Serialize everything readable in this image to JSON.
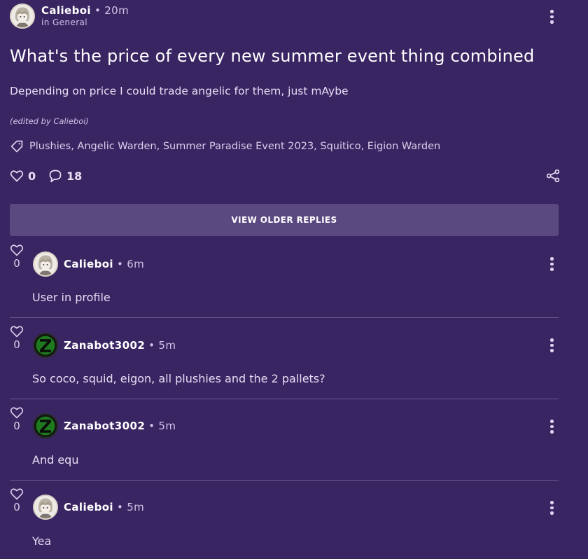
{
  "post": {
    "author": "Calieboi",
    "separator": "•",
    "time": "20m",
    "category": "in General",
    "title": "What's the price of every new summer event thing combined",
    "body": "Depending on price I could trade angelic for them, just mAybe",
    "edited_note": "(edited by Calieboi)",
    "tags": "Plushies, Angelic Warden, Summer Paradise Event 2023, Squitico, Eigion Warden",
    "likes": "0",
    "comments": "18"
  },
  "older_replies_label": "VIEW OLDER REPLIES",
  "replies": [
    {
      "author": "Calieboi",
      "time": "6m",
      "likes": "0",
      "text": "User in profile",
      "avatar": "calieboi-avatar"
    },
    {
      "author": "Zanabot3002",
      "time": "5m",
      "likes": "0",
      "text": "So coco, squid, eigon, all plushies and the 2 pallets?",
      "avatar": "zanabot-avatar"
    },
    {
      "author": "Zanabot3002",
      "time": "5m",
      "likes": "0",
      "text": "And equ",
      "avatar": "zanabot-avatar"
    },
    {
      "author": "Calieboi",
      "time": "5m",
      "likes": "0",
      "text": "Yea",
      "avatar": "calieboi-avatar"
    }
  ],
  "icons": {
    "more": "more-vertical-icon",
    "tag": "tag-icon",
    "heart": "heart-icon",
    "comment": "comment-icon",
    "share": "share-icon"
  },
  "colors": {
    "background": "#3a2563",
    "button": "#5a4880",
    "divider": "#6c5b90",
    "text_muted": "#cfc4e6"
  }
}
